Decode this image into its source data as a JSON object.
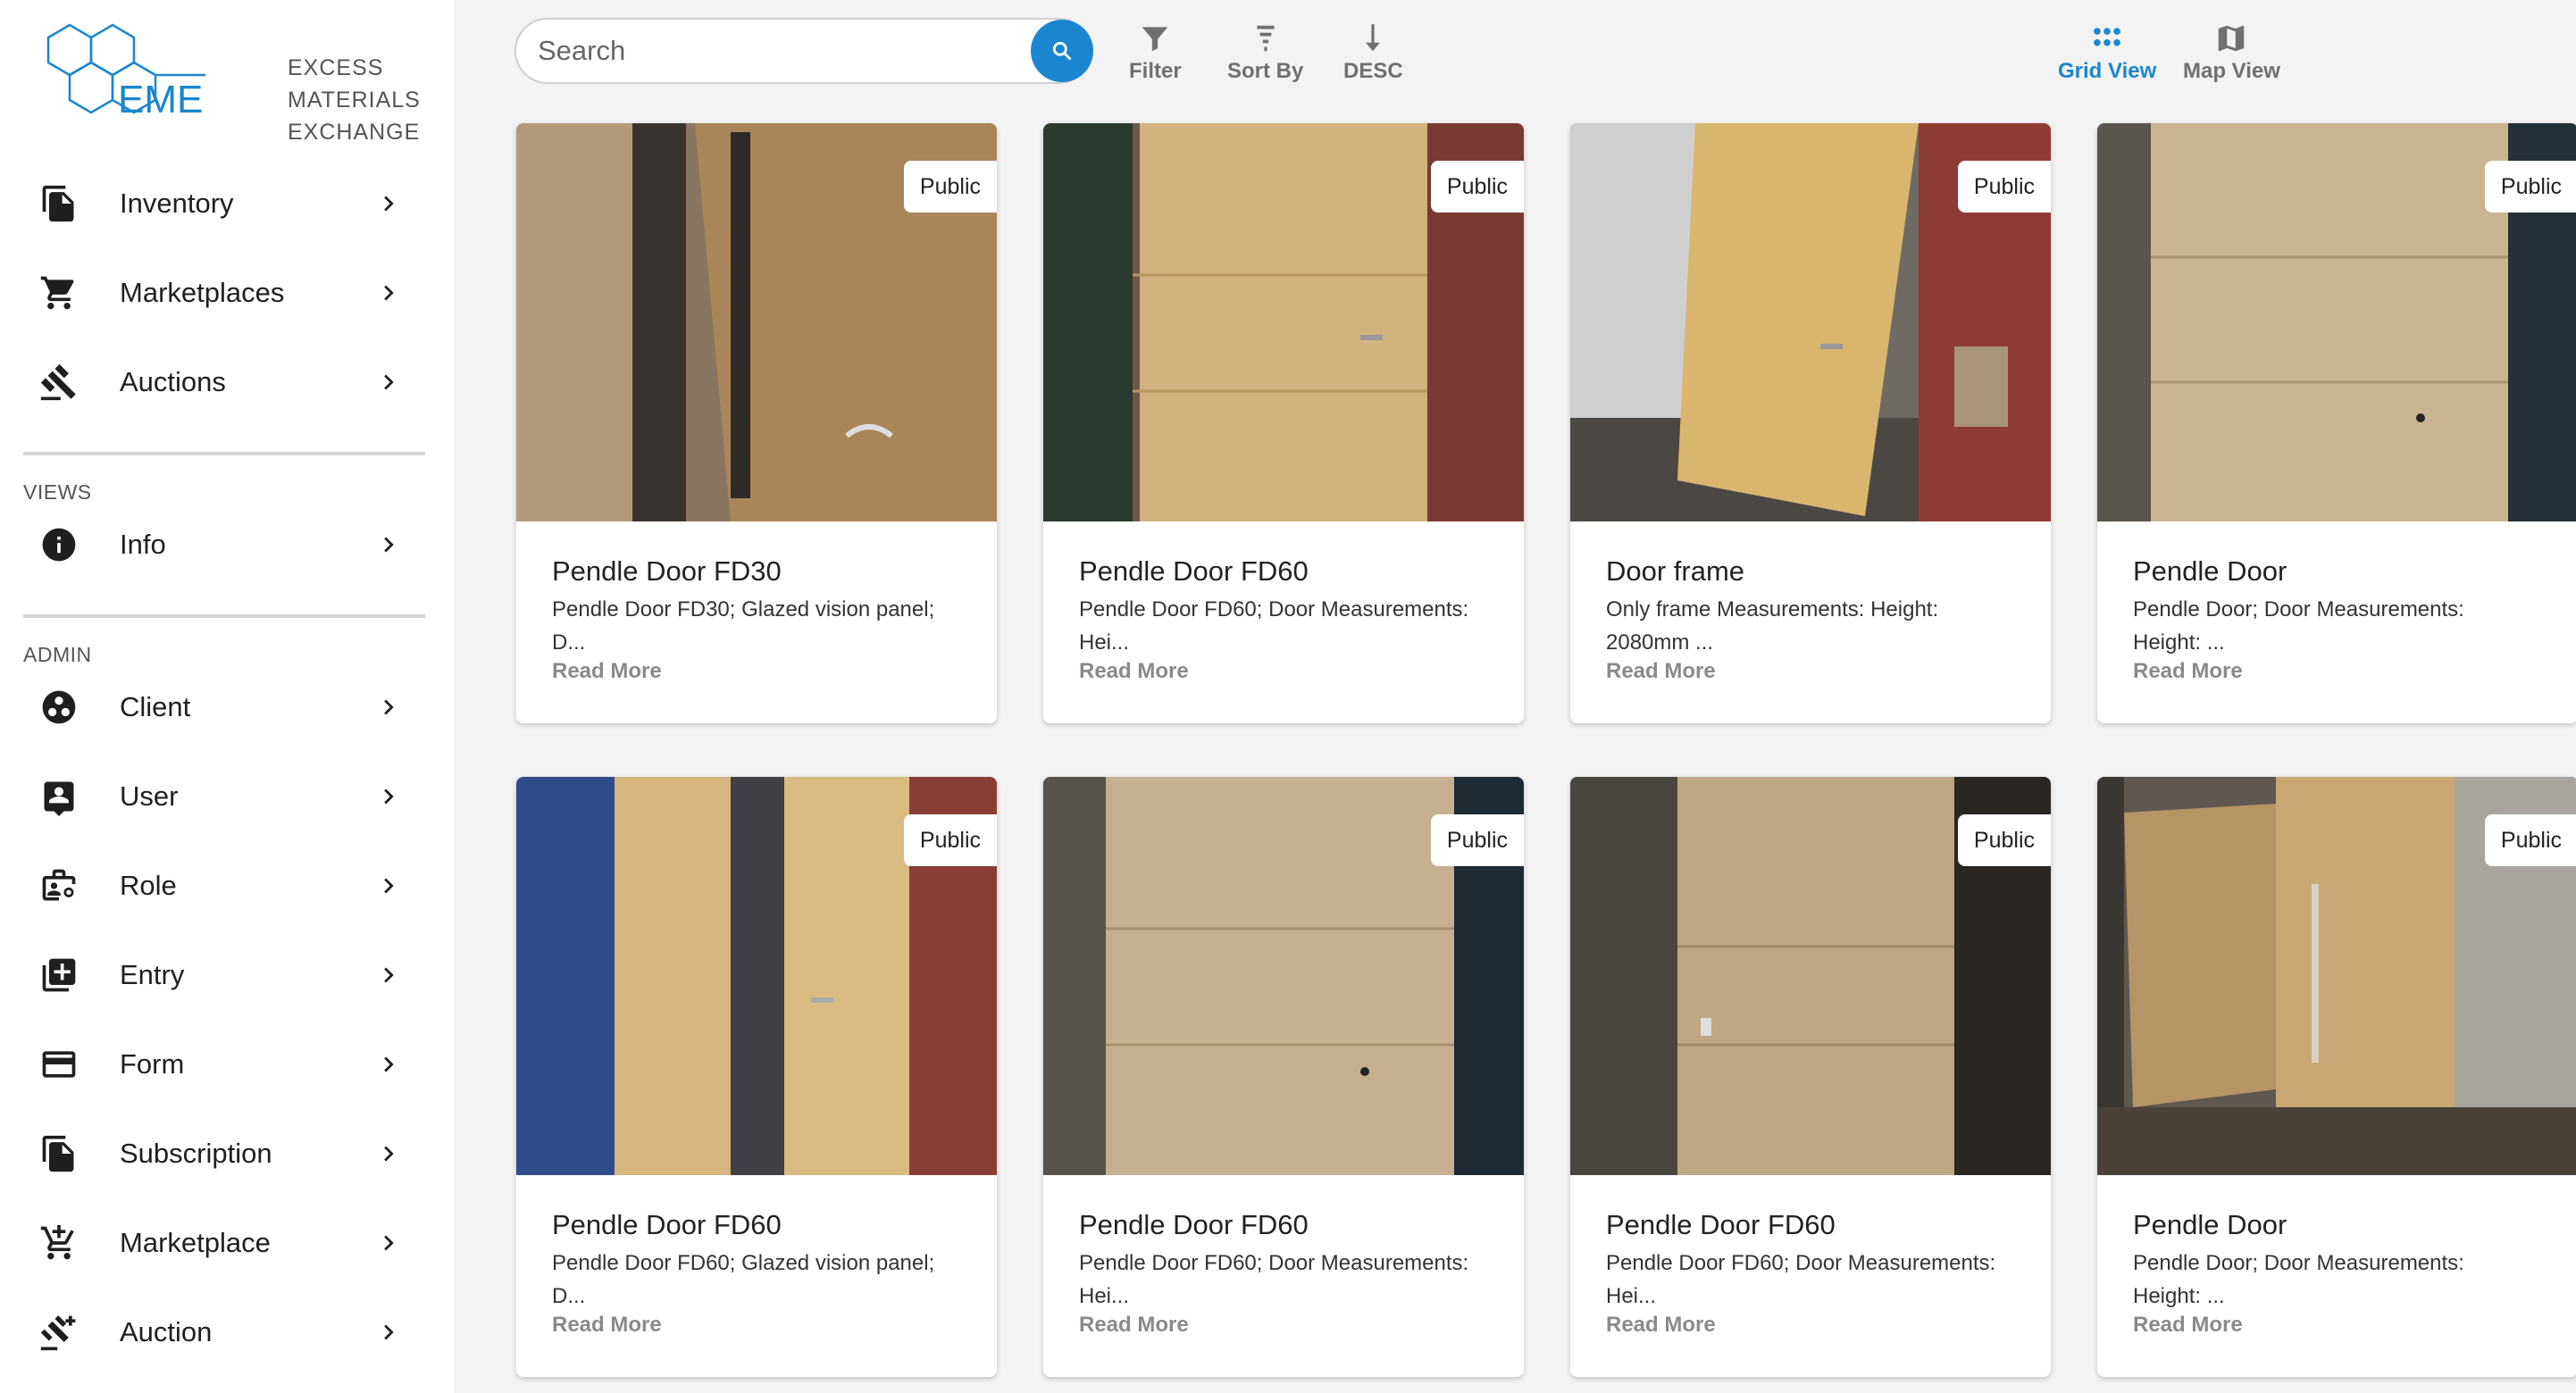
{
  "brand": {
    "logo_letters": "EME",
    "logo_line1": "EXCESS",
    "logo_line2": "MATERIALS",
    "logo_line3": "EXCHANGE",
    "accent_color": "#1a86d0"
  },
  "sidebar": {
    "main_items": [
      {
        "label": "Inventory",
        "icon": "inventory-icon"
      },
      {
        "label": "Marketplaces",
        "icon": "cart-icon"
      },
      {
        "label": "Auctions",
        "icon": "gavel-icon"
      }
    ],
    "views_label": "VIEWS",
    "views_items": [
      {
        "label": "Info",
        "icon": "info-icon"
      }
    ],
    "admin_label": "ADMIN",
    "admin_items": [
      {
        "label": "Client",
        "icon": "client-icon"
      },
      {
        "label": "User",
        "icon": "user-icon"
      },
      {
        "label": "Role",
        "icon": "role-icon"
      },
      {
        "label": "Entry",
        "icon": "add-box-icon"
      },
      {
        "label": "Form",
        "icon": "form-icon"
      },
      {
        "label": "Subscription",
        "icon": "subscription-icon"
      },
      {
        "label": "Marketplace",
        "icon": "add-cart-icon"
      },
      {
        "label": "Auction",
        "icon": "auction-icon"
      }
    ]
  },
  "toolbar": {
    "search_placeholder": "Search",
    "filter_label": "Filter",
    "sort_label": "Sort By",
    "order_label": "DESC",
    "grid_view_label": "Grid View",
    "map_view_label": "Map View"
  },
  "listings": [
    {
      "title": "Pendle Door FD30",
      "desc_line1": "Pendle Door FD30; Glazed vision panel;",
      "desc_line2": "D...",
      "badge": "Public",
      "read_more": "Read More"
    },
    {
      "title": "Pendle Door FD60",
      "desc_line1": "Pendle Door FD60; Door Measurements:",
      "desc_line2": "Hei...",
      "badge": "Public",
      "read_more": "Read More"
    },
    {
      "title": "Door frame",
      "desc_line1": "Only frame Measurements: Height:",
      "desc_line2": "2080mm ...",
      "badge": "Public",
      "read_more": "Read More"
    },
    {
      "title": "Pendle Door",
      "desc_line1": "Pendle Door; Door Measurements:",
      "desc_line2": "Height: ...",
      "badge": "Public",
      "read_more": "Read More"
    },
    {
      "title": "Pendle Door FD60",
      "desc_line1": "Pendle Door FD60; Glazed vision panel;",
      "desc_line2": "D...",
      "badge": "Public",
      "read_more": "Read More"
    },
    {
      "title": "Pendle Door FD60",
      "desc_line1": "Pendle Door FD60; Door Measurements:",
      "desc_line2": "Hei...",
      "badge": "Public",
      "read_more": "Read More"
    },
    {
      "title": "Pendle Door FD60",
      "desc_line1": "Pendle Door FD60; Door Measurements:",
      "desc_line2": "Hei...",
      "badge": "Public",
      "read_more": "Read More"
    },
    {
      "title": "Pendle Door",
      "desc_line1": "Pendle Door; Door Measurements:",
      "desc_line2": "Height: ...",
      "badge": "Public",
      "read_more": "Read More"
    }
  ]
}
